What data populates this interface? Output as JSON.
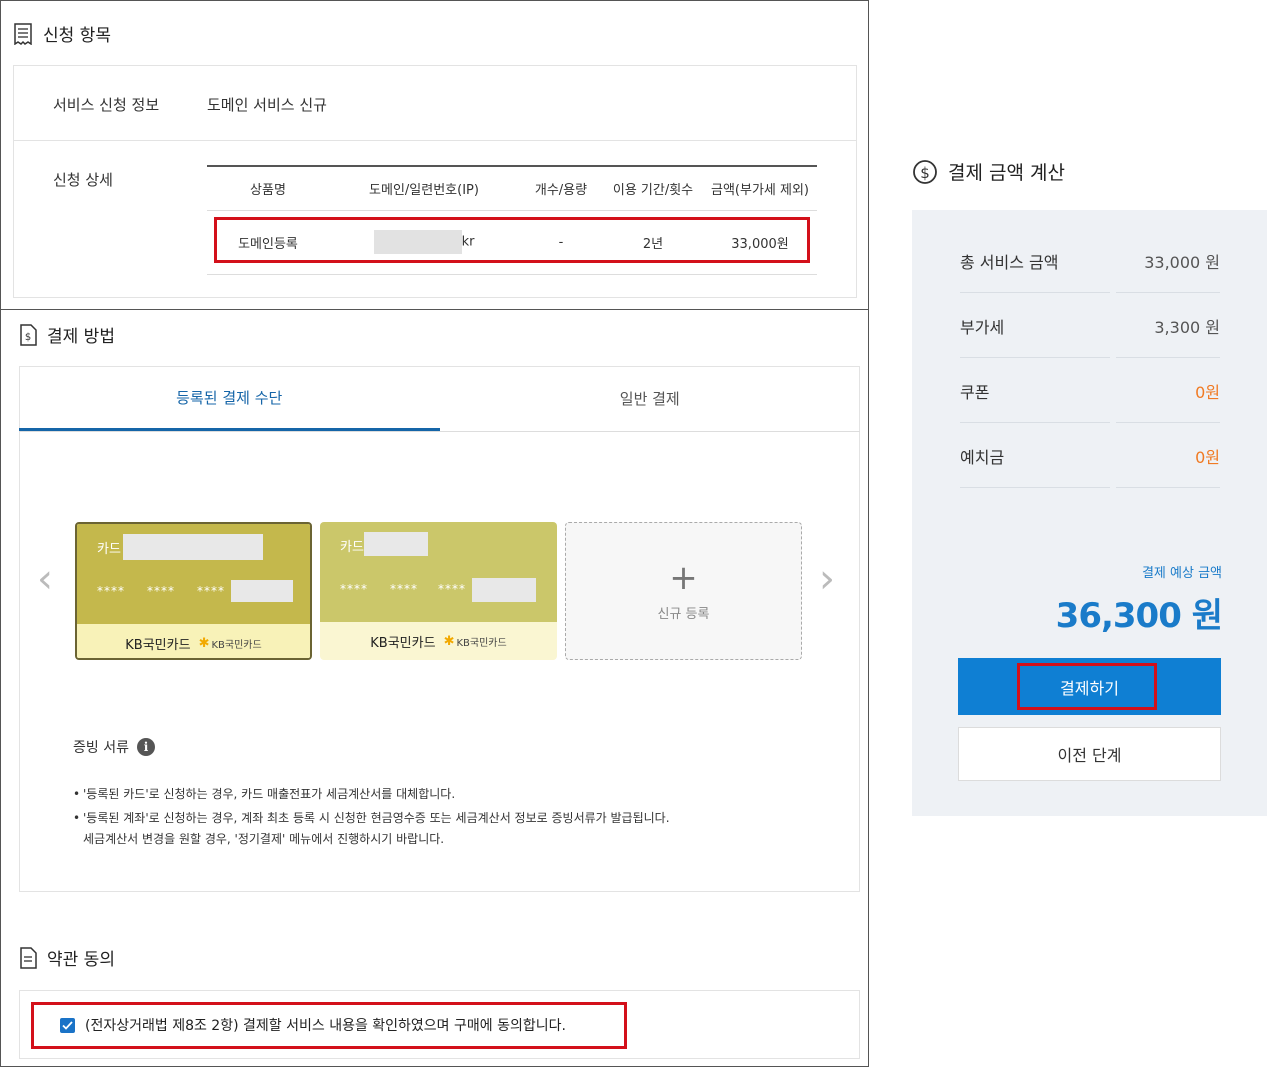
{
  "apply": {
    "title": "신청 항목",
    "info_label": "서비스 신청 정보",
    "info_value": "도메인 서비스 신규",
    "detail_label": "신청 상세",
    "table": {
      "headers": [
        "상품명",
        "도메인/일련번호(IP)",
        "개수/용량",
        "이용 기간/횟수",
        "금액(부가세 제외)"
      ],
      "row": {
        "product": "도메인등록",
        "domain_suffix": "kr",
        "quantity": "-",
        "period": "2년",
        "amount": "33,000원"
      }
    }
  },
  "payment": {
    "title": "결제 방법",
    "tabs": [
      {
        "label": "등록된 결제 수단"
      },
      {
        "label": "일반 결제"
      }
    ],
    "cards": [
      {
        "kind": "카드",
        "stars": [
          "****",
          "****",
          "****"
        ],
        "issuer": "KB국민카드",
        "logo_text": "KB국민카드"
      },
      {
        "kind": "카드",
        "stars": [
          "****",
          "****",
          "****"
        ],
        "issuer": "KB국민카드",
        "logo_text": "KB국민카드"
      }
    ],
    "new_card_label": "신규 등록",
    "doc_title": "증빙 서류",
    "notes": [
      "'등록된 카드'로 신청하는 경우, 카드 매출전표가 세금계산서를 대체합니다.",
      "'등록된 계좌'로 신청하는 경우, 계좌 최초 등록 시 신청한 현금영수증 또는 세금계산서 정보로 증빙서류가 발급됩니다.",
      "세금계산서 변경을 원할 경우, '정기결제' 메뉴에서 진행하시기 바랍니다."
    ]
  },
  "terms": {
    "title": "약관 동의",
    "agree_text": "(전자상거래법 제8조 2항) 결제할 서비스 내용을 확인하였으며 구매에 동의합니다."
  },
  "calc": {
    "title": "결제 금액 계산",
    "rows": [
      {
        "label": "총 서비스 금액",
        "value": "33,000 원"
      },
      {
        "label": "부가세",
        "value": "3,300 원"
      },
      {
        "label": "쿠폰",
        "value": "0원"
      },
      {
        "label": "예치금",
        "value": "0원"
      }
    ],
    "est_label": "결제 예상 금액",
    "est_amount": "36,300 원",
    "pay_button": "결제하기",
    "prev_button": "이전 단계"
  },
  "colors": {
    "accent": "#0f7fd3",
    "highlight": "#d3101a",
    "discount": "#f07a23",
    "card1": "#c4b84c",
    "card2": "#cbc76a"
  }
}
